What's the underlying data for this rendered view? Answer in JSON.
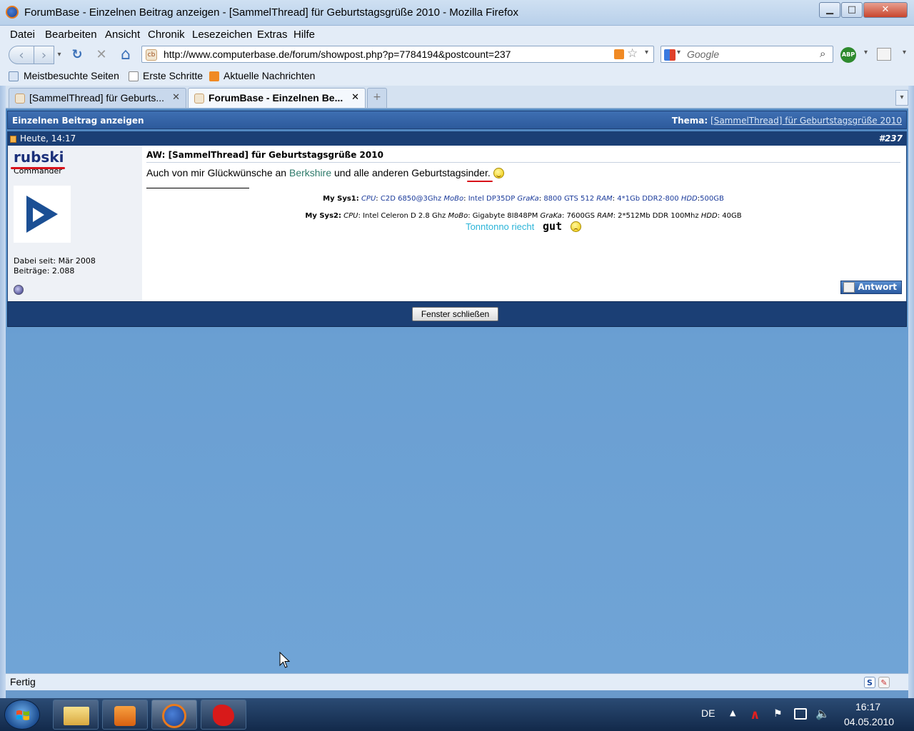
{
  "window": {
    "title": "ForumBase - Einzelnen Beitrag anzeigen - [SammelThread] für Geburtstagsgrüße 2010 - Mozilla Firefox",
    "minimize": "▁",
    "maximize": "□",
    "close": "✕"
  },
  "menu": [
    "Datei",
    "Bearbeiten",
    "Ansicht",
    "Chronik",
    "Lesezeichen",
    "Extras",
    "Hilfe"
  ],
  "nav": {
    "back": "‹",
    "forward": "›",
    "reload": "↻",
    "stop": "✕",
    "home": "⌂",
    "url": "http://www.computerbase.de/forum/showpost.php?p=7784194&postcount=237",
    "search_placeholder": "Google",
    "abp": "ABP"
  },
  "bookmarks": [
    "Meistbesuchte Seiten",
    "Erste Schritte",
    "Aktuelle Nachrichten"
  ],
  "tabs": [
    {
      "label": "[SammelThread] für Geburts..."
    },
    {
      "label": "ForumBase - Einzelnen Be..."
    }
  ],
  "page": {
    "header_left": "Einzelnen Beitrag anzeigen",
    "header_right_label": "Thema:",
    "header_right_link": "[SammelThread] für Geburtstagsgrüße 2010",
    "post_date": "Heute, 14:17",
    "post_number": "#237",
    "user": {
      "name": "rubski",
      "title": "Commander",
      "joined": "Dabei seit: Mär 2008",
      "posts": "Beiträge: 2.088"
    },
    "post": {
      "title": "AW: [SammelThread] für Geburtstagsgrüße 2010",
      "text_before": "Auch von mir Glückwünsche an",
      "link": "Berkshire",
      "text_after": "und alle anderen Geburtstagsinder."
    },
    "sig": {
      "sys1_label": "My Sys1:",
      "sys1": [
        {
          "k": "CPU",
          "v": "C2D 6850@3Ghz"
        },
        {
          "k": "MoBo",
          "v": "Intel DP35DP"
        },
        {
          "k": "GraKa",
          "v": "8800 GTS 512"
        },
        {
          "k": "RAM",
          "v": "4*1Gb DDR2-800"
        },
        {
          "k": "HDD",
          "v": "500GB"
        }
      ],
      "sys2_label": "My Sys2:",
      "sys2": [
        {
          "k": "CPU",
          "v": "Intel Celeron D 2.8 Ghz"
        },
        {
          "k": "MoBo",
          "v": "Gigabyte 8I848PM"
        },
        {
          "k": "GraKa",
          "v": "7600GS"
        },
        {
          "k": "RAM",
          "v": "2*512Mb DDR 100Mhz"
        },
        {
          "k": "HDD",
          "v": "40GB"
        }
      ],
      "line3_a": "Tonntonno riecht",
      "line3_b": "gut"
    },
    "reply_button": "Antwort",
    "close_button": "Fenster schließen"
  },
  "status": {
    "text": "Fertig"
  },
  "taskbar": {
    "lang": "DE",
    "time": "16:17",
    "date": "04.05.2010"
  },
  "colors": {
    "header_blue": "#2d5a9c",
    "dark_blue": "#1b3f75",
    "username": "#1a2f7a",
    "link_green": "#2e7a6a",
    "sig_cyan": "#2bb4d8",
    "red_mark": "#d8121a"
  }
}
